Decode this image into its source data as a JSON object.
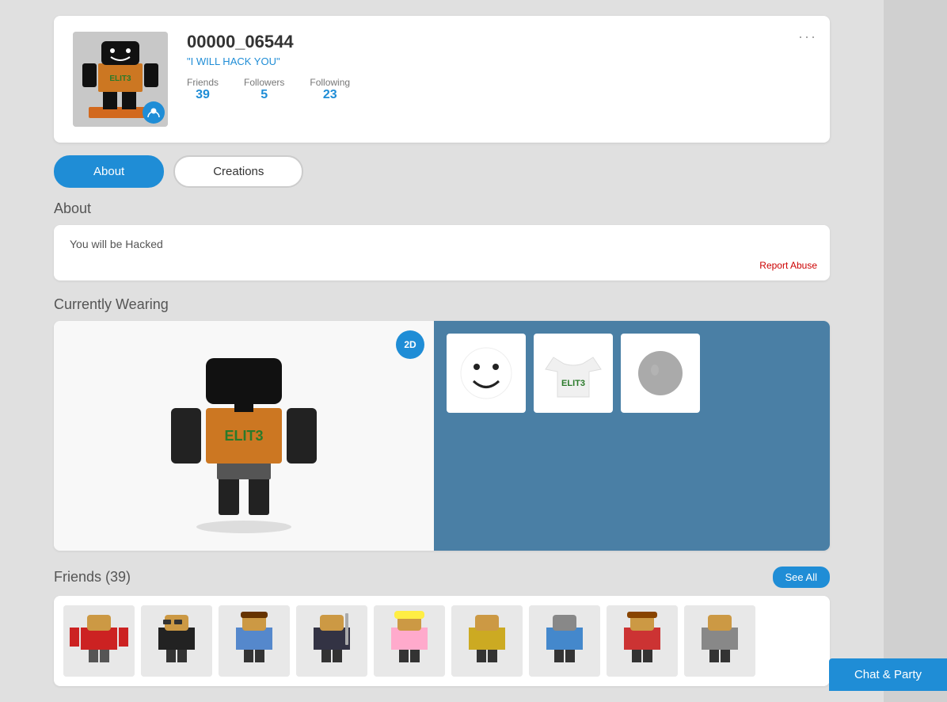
{
  "profile": {
    "username": "00000_06544",
    "tagline": "\"I WILL HACK YOU\"",
    "friends_label": "Friends",
    "friends_count": "39",
    "followers_label": "Followers",
    "followers_count": "5",
    "following_label": "Following",
    "following_count": "23"
  },
  "tabs": {
    "about_label": "About",
    "creations_label": "Creations"
  },
  "about": {
    "title": "About",
    "description": "You will be Hacked",
    "report_label": "Report Abuse"
  },
  "wearing": {
    "title": "Currently Wearing",
    "badge": "2D"
  },
  "friends": {
    "title": "Friends (39)",
    "see_all": "See All"
  },
  "chat": {
    "label": "Chat & Party"
  },
  "more_options": "···"
}
